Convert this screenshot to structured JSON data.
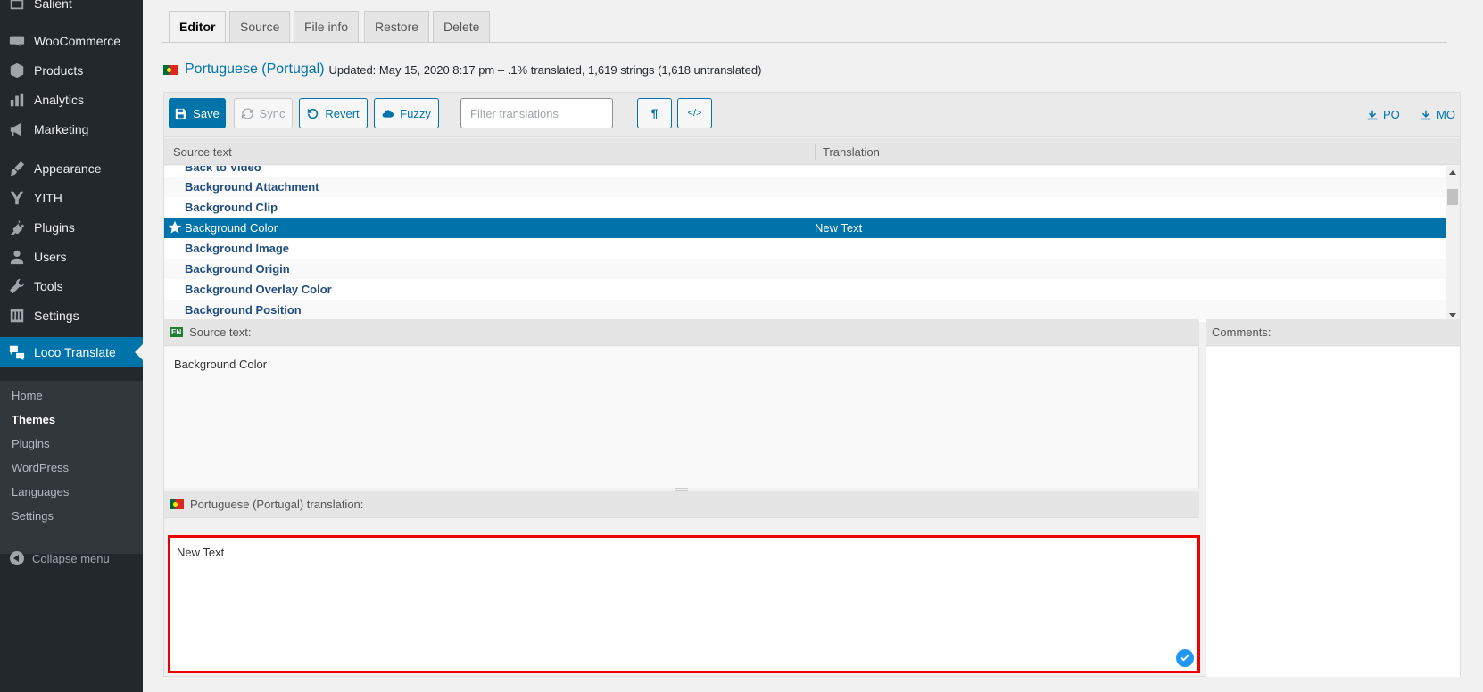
{
  "sidebar": {
    "items": [
      {
        "label": "Salient",
        "icon": "window-icon"
      },
      {
        "label": "WooCommerce",
        "icon": "woo-icon"
      },
      {
        "label": "Products",
        "icon": "box-icon"
      },
      {
        "label": "Analytics",
        "icon": "bar-chart-icon"
      },
      {
        "label": "Marketing",
        "icon": "megaphone-icon"
      },
      {
        "label": "Appearance",
        "icon": "brush-icon"
      },
      {
        "label": "YITH",
        "icon": "yith-icon"
      },
      {
        "label": "Plugins",
        "icon": "plug-icon"
      },
      {
        "label": "Users",
        "icon": "user-icon"
      },
      {
        "label": "Tools",
        "icon": "wrench-icon"
      },
      {
        "label": "Settings",
        "icon": "sliders-icon"
      },
      {
        "label": "Loco Translate",
        "icon": "translate-icon"
      }
    ],
    "submenu": [
      "Home",
      "Themes",
      "Plugins",
      "WordPress",
      "Languages",
      "Settings"
    ],
    "current_submenu": "Themes",
    "collapse_label": "Collapse menu"
  },
  "tabs": [
    "Editor",
    "Source",
    "File info",
    "Restore",
    "Delete"
  ],
  "active_tab": "Editor",
  "heading": {
    "language": "Portuguese (Portugal)",
    "meta": "Updated: May 15, 2020 8:17 pm – .1% translated, 1,619 strings (1,618 untranslated)"
  },
  "toolbar": {
    "save": "Save",
    "sync": "Sync",
    "revert": "Revert",
    "fuzzy": "Fuzzy",
    "filter_placeholder": "Filter translations",
    "pilcrow": "¶",
    "code": "</>",
    "po": "PO",
    "mo": "MO"
  },
  "grid": {
    "col_source": "Source text",
    "col_translation": "Translation",
    "rows": [
      {
        "source": "Back to Video",
        "translation": ""
      },
      {
        "source": "Background Attachment",
        "translation": ""
      },
      {
        "source": "Background Clip",
        "translation": ""
      },
      {
        "source": "Background Color",
        "translation": "New Text",
        "selected": true
      },
      {
        "source": "Background Image",
        "translation": ""
      },
      {
        "source": "Background Origin",
        "translation": ""
      },
      {
        "source": "Background Overlay Color",
        "translation": ""
      },
      {
        "source": "Background Position",
        "translation": ""
      }
    ]
  },
  "source_panel": {
    "badge": "EN",
    "title": "Source text:",
    "text": "Background Color"
  },
  "comments_panel": {
    "title": "Comments:"
  },
  "translation_panel": {
    "title": "Portuguese (Portugal) translation:",
    "text": "New Text"
  },
  "colors": {
    "accent": "#0073aa",
    "sidebar": "#23282d",
    "highlight_border": "#ee0000"
  }
}
